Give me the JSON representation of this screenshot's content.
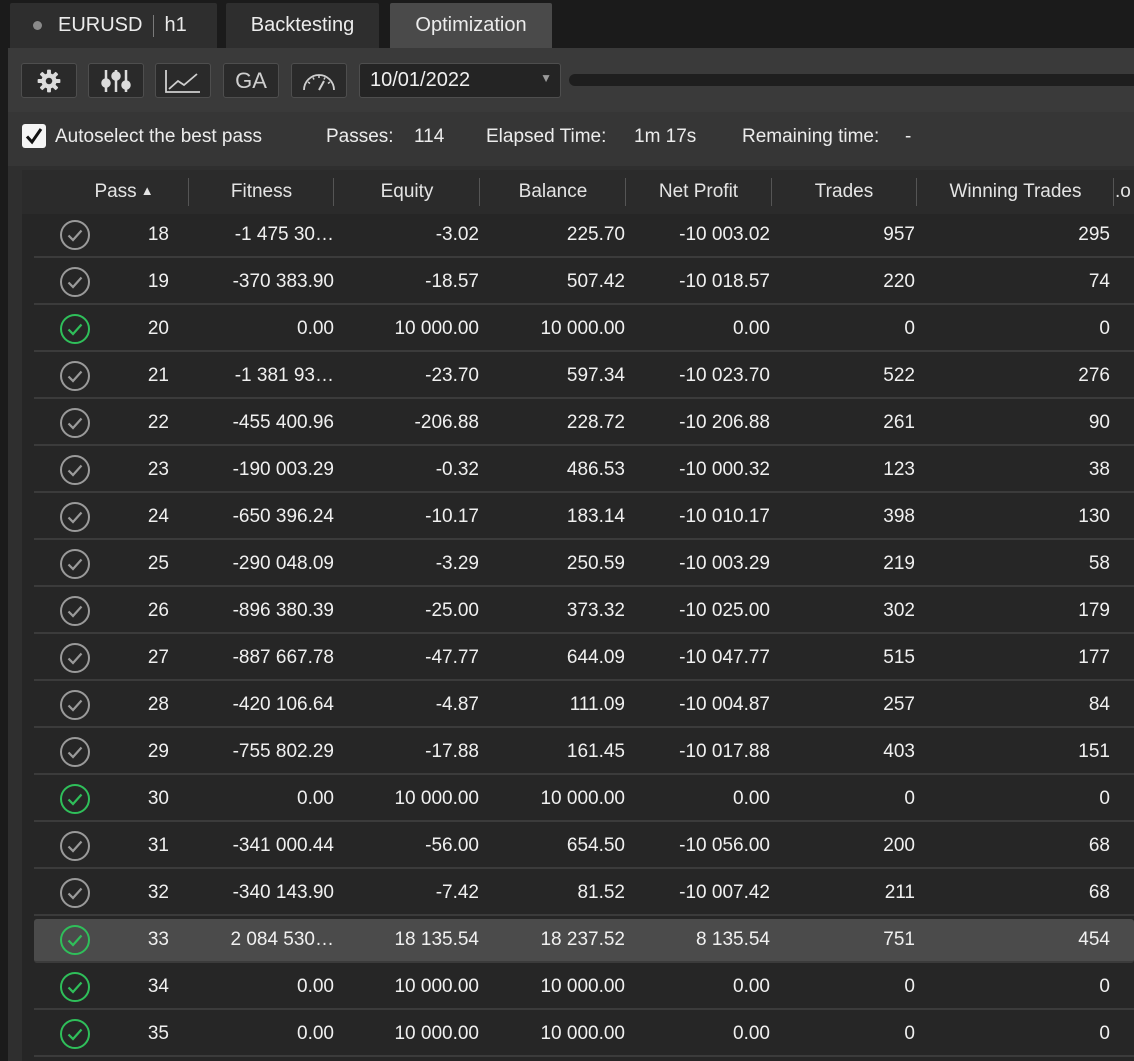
{
  "tabs": {
    "symbol": "EURUSD",
    "timeframe": "h1",
    "backtesting": "Backtesting",
    "optimization": "Optimization"
  },
  "toolbar": {
    "ga_label": "GA",
    "date": "10/01/2022"
  },
  "status": {
    "autoselect_label": "Autoselect the best pass",
    "autoselect_checked": true,
    "passes_label": "Passes:",
    "passes_value": "114",
    "elapsed_label": "Elapsed Time:",
    "elapsed_value": "1m 17s",
    "remaining_label": "Remaining time:",
    "remaining_value": "-"
  },
  "table": {
    "columns": [
      "Pass",
      "Fitness",
      "Equity",
      "Balance",
      "Net Profit",
      "Trades",
      "Winning Trades",
      ".o"
    ],
    "sort_column": "Pass",
    "sort_direction": "ascending",
    "rows": [
      {
        "status": "ok",
        "pass": "18",
        "fitness": "-1 475 30…",
        "equity": "-3.02",
        "balance": "225.70",
        "net_profit": "-10 003.02",
        "trades": "957",
        "winning": "295"
      },
      {
        "status": "ok",
        "pass": "19",
        "fitness": "-370 383.90",
        "equity": "-18.57",
        "balance": "507.42",
        "net_profit": "-10 018.57",
        "trades": "220",
        "winning": "74"
      },
      {
        "status": "best",
        "pass": "20",
        "fitness": "0.00",
        "equity": "10 000.00",
        "balance": "10 000.00",
        "net_profit": "0.00",
        "trades": "0",
        "winning": "0"
      },
      {
        "status": "ok",
        "pass": "21",
        "fitness": "-1 381 93…",
        "equity": "-23.70",
        "balance": "597.34",
        "net_profit": "-10 023.70",
        "trades": "522",
        "winning": "276"
      },
      {
        "status": "ok",
        "pass": "22",
        "fitness": "-455 400.96",
        "equity": "-206.88",
        "balance": "228.72",
        "net_profit": "-10 206.88",
        "trades": "261",
        "winning": "90"
      },
      {
        "status": "ok",
        "pass": "23",
        "fitness": "-190 003.29",
        "equity": "-0.32",
        "balance": "486.53",
        "net_profit": "-10 000.32",
        "trades": "123",
        "winning": "38"
      },
      {
        "status": "ok",
        "pass": "24",
        "fitness": "-650 396.24",
        "equity": "-10.17",
        "balance": "183.14",
        "net_profit": "-10 010.17",
        "trades": "398",
        "winning": "130"
      },
      {
        "status": "ok",
        "pass": "25",
        "fitness": "-290 048.09",
        "equity": "-3.29",
        "balance": "250.59",
        "net_profit": "-10 003.29",
        "trades": "219",
        "winning": "58"
      },
      {
        "status": "ok",
        "pass": "26",
        "fitness": "-896 380.39",
        "equity": "-25.00",
        "balance": "373.32",
        "net_profit": "-10 025.00",
        "trades": "302",
        "winning": "179"
      },
      {
        "status": "ok",
        "pass": "27",
        "fitness": "-887 667.78",
        "equity": "-47.77",
        "balance": "644.09",
        "net_profit": "-10 047.77",
        "trades": "515",
        "winning": "177"
      },
      {
        "status": "ok",
        "pass": "28",
        "fitness": "-420 106.64",
        "equity": "-4.87",
        "balance": "111.09",
        "net_profit": "-10 004.87",
        "trades": "257",
        "winning": "84"
      },
      {
        "status": "ok",
        "pass": "29",
        "fitness": "-755 802.29",
        "equity": "-17.88",
        "balance": "161.45",
        "net_profit": "-10 017.88",
        "trades": "403",
        "winning": "151"
      },
      {
        "status": "best",
        "pass": "30",
        "fitness": "0.00",
        "equity": "10 000.00",
        "balance": "10 000.00",
        "net_profit": "0.00",
        "trades": "0",
        "winning": "0"
      },
      {
        "status": "ok",
        "pass": "31",
        "fitness": "-341 000.44",
        "equity": "-56.00",
        "balance": "654.50",
        "net_profit": "-10 056.00",
        "trades": "200",
        "winning": "68"
      },
      {
        "status": "ok",
        "pass": "32",
        "fitness": "-340 143.90",
        "equity": "-7.42",
        "balance": "81.52",
        "net_profit": "-10 007.42",
        "trades": "211",
        "winning": "68"
      },
      {
        "status": "best",
        "selected": true,
        "pass": "33",
        "fitness": "2 084 530…",
        "equity": "18 135.54",
        "balance": "18 237.52",
        "net_profit": "8 135.54",
        "trades": "751",
        "winning": "454"
      },
      {
        "status": "best",
        "pass": "34",
        "fitness": "0.00",
        "equity": "10 000.00",
        "balance": "10 000.00",
        "net_profit": "0.00",
        "trades": "0",
        "winning": "0"
      },
      {
        "status": "best",
        "pass": "35",
        "fitness": "0.00",
        "equity": "10 000.00",
        "balance": "10 000.00",
        "net_profit": "0.00",
        "trades": "0",
        "winning": "0"
      }
    ]
  },
  "colors": {
    "ok_icon": "#9a9a9a",
    "best_icon": "#2fbf5a",
    "selected_row": "#4b4b4b"
  },
  "icons": [
    "gear-icon",
    "sliders-icon",
    "chart-icon",
    "gauge-icon",
    "dropdown-arrow-icon",
    "sort-ascending-icon",
    "check-circle-icon",
    "checkbox-icon"
  ]
}
